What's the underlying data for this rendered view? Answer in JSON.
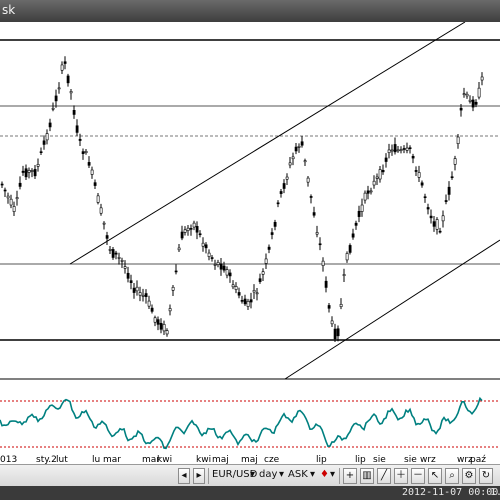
{
  "window": {
    "title": "sk"
  },
  "chart": {
    "x_labels": [
      "013",
      "sty.2",
      "lut",
      "lu",
      "mar",
      "mar",
      "kwi",
      "kwi",
      "maj",
      "maj",
      "cze",
      "lip",
      "lip",
      "sie",
      "sie",
      "wrz",
      "wrz",
      "paź"
    ],
    "colors": {
      "price": "#000000",
      "oscillator": "#008080",
      "osc_level": "#cc0000"
    }
  },
  "toolbar": {
    "symbol": "EUR/USD",
    "period": "day",
    "price_type": "ASK",
    "icons": [
      "scroll-left-icon",
      "scroll-right-icon",
      "zoom-in-icon",
      "zoom-out-icon",
      "magnifier-icon",
      "settings-icon",
      "refresh-icon"
    ]
  },
  "status": {
    "timestamp": "2012-11-07 00:00:00",
    "value": "1."
  }
}
